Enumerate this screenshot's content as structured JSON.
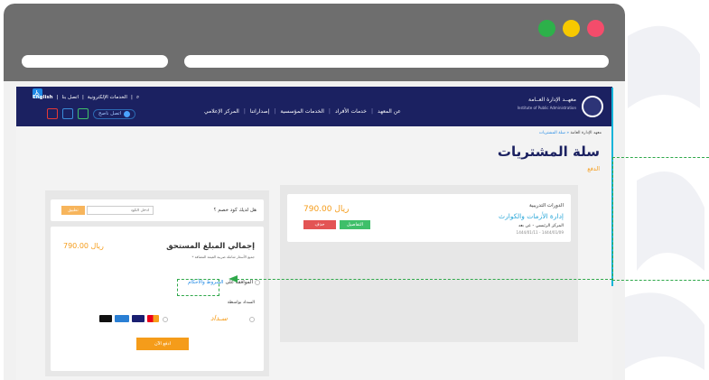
{
  "site": {
    "logo_name": "معهــد الإدارة العــامة",
    "logo_sub": "Institute of Public Administration",
    "nav": [
      "عن المعهد",
      "خدمات الأفراد",
      "الخدمات المؤسسية",
      "إصداراتنا",
      "المركز الإعلامي"
    ],
    "topbar": [
      "الخدمات الإلكترونية",
      "اتصل بنا",
      "English"
    ],
    "search_label": "اتصل ناصح"
  },
  "breadcrumb": {
    "home": "معهد الإدارة العامة",
    "current": "سلة المشتريات"
  },
  "page": {
    "title": "سلة المشتريات",
    "subtitle": "الدفع"
  },
  "course": {
    "type": "الدورات التدريبية",
    "name": "إدارة الأزمات والكوارث",
    "location": "المركز الرئيسي - عن بعد",
    "dates": "1444/01/11 - 1444/01/09",
    "price": "790.00 ريال",
    "details_label": "التفاصيل",
    "delete_label": "حذف"
  },
  "coupon": {
    "question": "هل لديك كود خصم ؟",
    "placeholder": "ادخل الكود",
    "apply_label": "تطبيق"
  },
  "summary": {
    "total_label": "إجمالي المبلغ المستحق",
    "total_note": "* جميع الأسعار شاملة ضريبة القيمة المضافة",
    "total_price": "790.00 ريال",
    "terms_prefix": "الموافقة على",
    "terms_link": "الشروط والأحكام",
    "pay_by": "السداد بواسطة",
    "sadad": "سـداد",
    "pay_now": "ادفع الآن"
  },
  "colors": {
    "header": "#1b2161",
    "accent": "#f59c1a",
    "link": "#2aa7d9",
    "success": "#3fbf6a",
    "danger": "#e35454",
    "annotation": "#2fa84a"
  }
}
